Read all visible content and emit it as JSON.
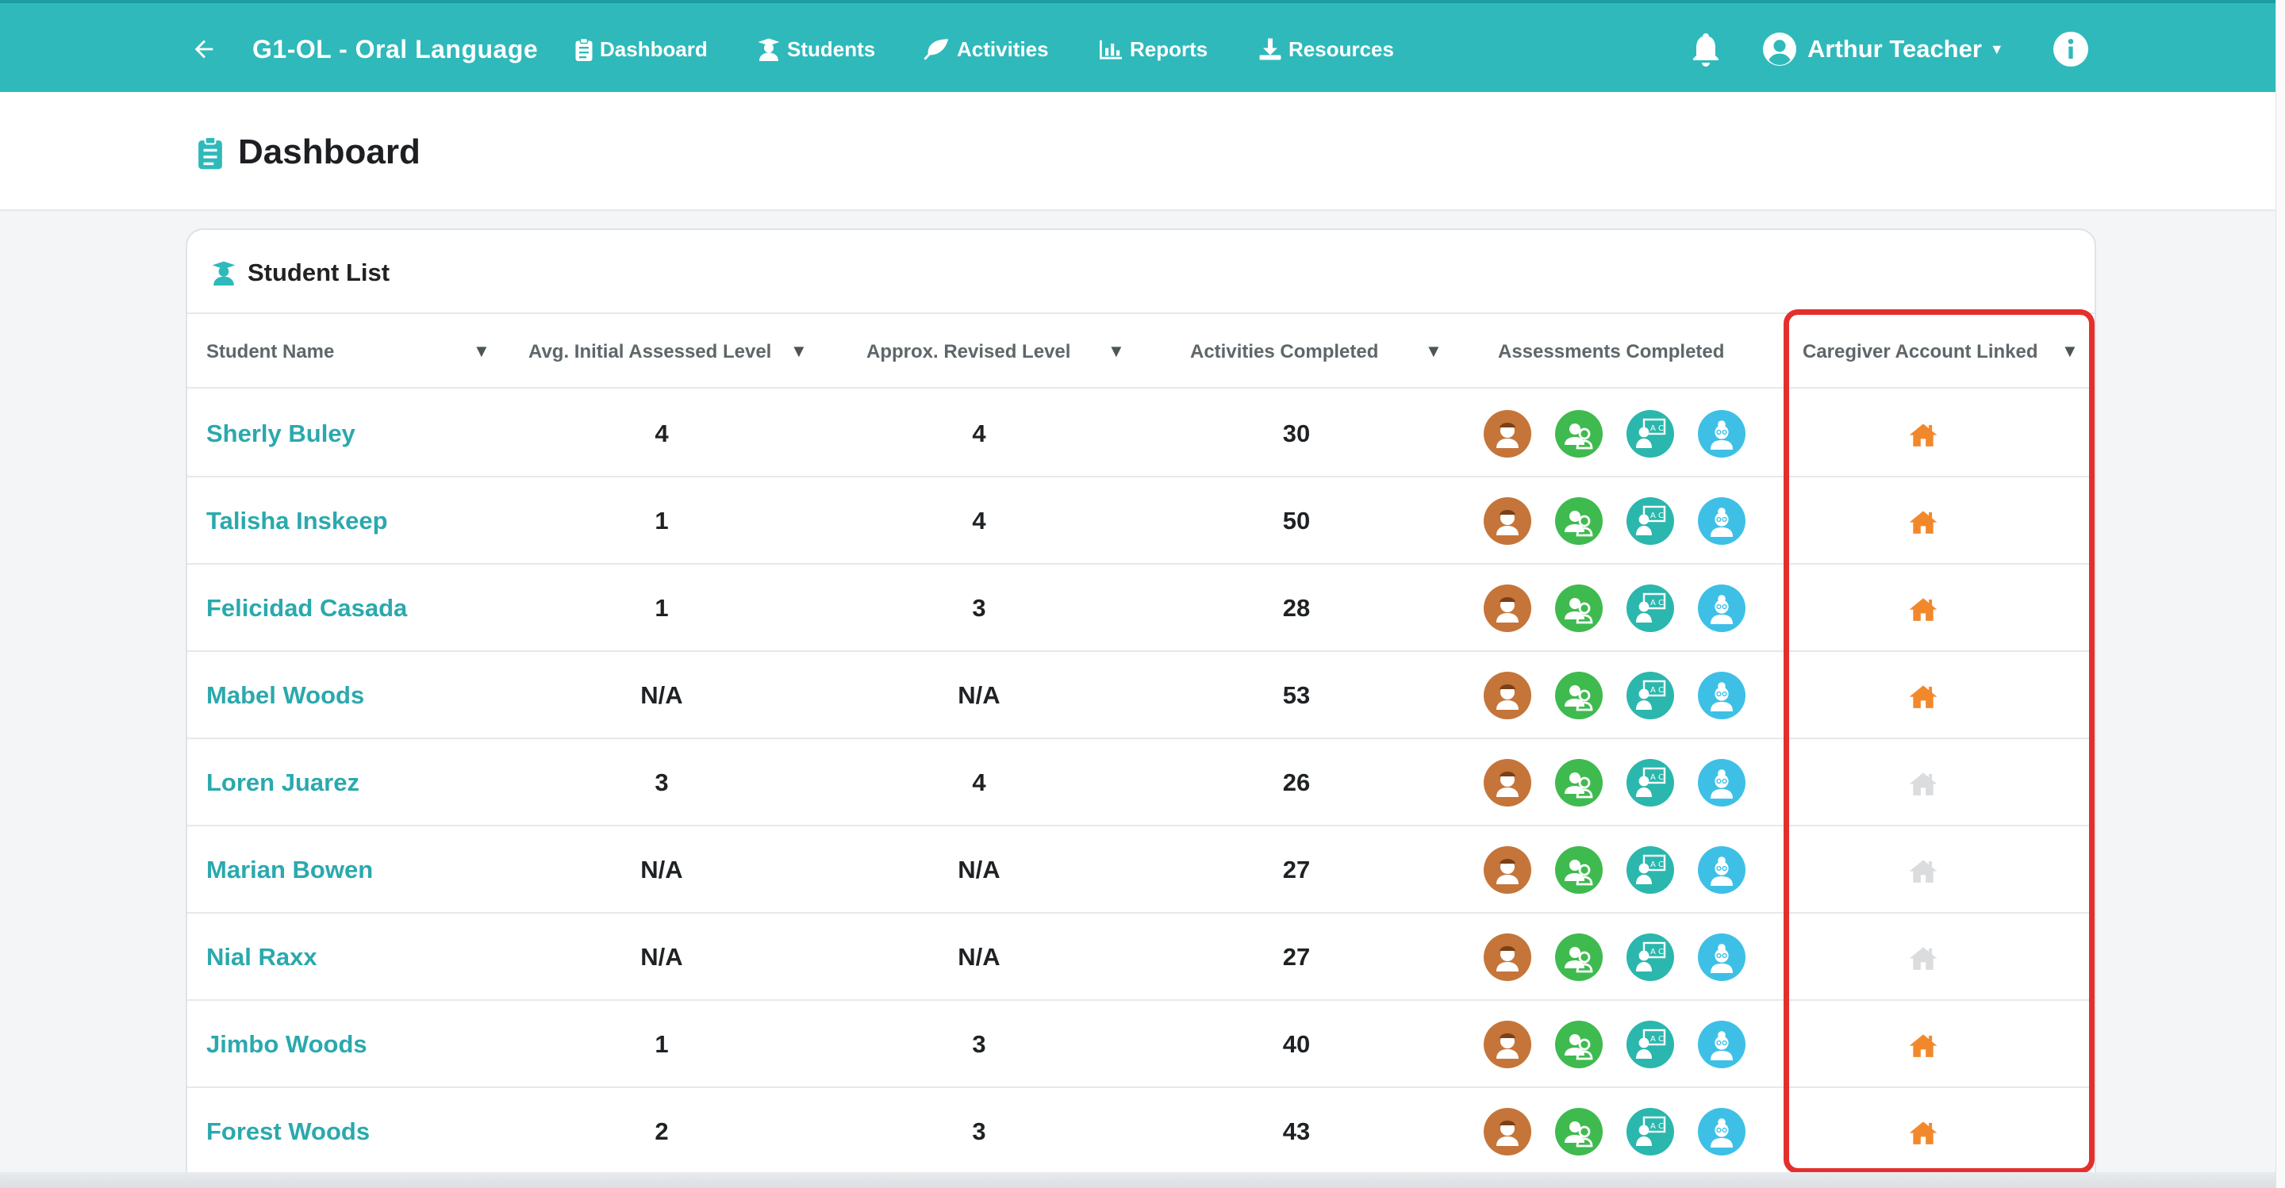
{
  "nav": {
    "back_icon": "arrow-left-icon",
    "course_title": "G1-OL - Oral Language",
    "links": [
      {
        "label": "Dashboard",
        "icon": "clipboard-icon"
      },
      {
        "label": "Students",
        "icon": "student-icon"
      },
      {
        "label": "Activities",
        "icon": "leaf-icon"
      },
      {
        "label": "Reports",
        "icon": "bar-chart-icon"
      },
      {
        "label": "Resources",
        "icon": "download-icon"
      }
    ],
    "bell_icon": "bell-icon",
    "user_name": "Arthur Teacher",
    "info_icon": "info-icon"
  },
  "page": {
    "title": "Dashboard"
  },
  "student_list": {
    "title": "Student List",
    "columns": {
      "name": "Student Name",
      "initial": "Avg. Initial Assessed Level",
      "revised": "Approx. Revised Level",
      "activities": "Activities Completed",
      "assessments": "Assessments Completed",
      "caregiver": "Caregiver Account Linked"
    },
    "rows": [
      {
        "name": "Sherly Buley",
        "initial": "4",
        "revised": "4",
        "activities": "30",
        "caregiver_linked": true
      },
      {
        "name": "Talisha Inskeep",
        "initial": "1",
        "revised": "4",
        "activities": "50",
        "caregiver_linked": true
      },
      {
        "name": "Felicidad Casada",
        "initial": "1",
        "revised": "3",
        "activities": "28",
        "caregiver_linked": true
      },
      {
        "name": "Mabel Woods",
        "initial": "N/A",
        "revised": "N/A",
        "activities": "53",
        "caregiver_linked": true
      },
      {
        "name": "Loren Juarez",
        "initial": "3",
        "revised": "4",
        "activities": "26",
        "caregiver_linked": false
      },
      {
        "name": "Marian Bowen",
        "initial": "N/A",
        "revised": "N/A",
        "activities": "27",
        "caregiver_linked": false
      },
      {
        "name": "Nial Raxx",
        "initial": "N/A",
        "revised": "N/A",
        "activities": "27",
        "caregiver_linked": false
      },
      {
        "name": "Jimbo Woods",
        "initial": "1",
        "revised": "3",
        "activities": "40",
        "caregiver_linked": true
      },
      {
        "name": "Forest Woods",
        "initial": "2",
        "revised": "3",
        "activities": "43",
        "caregiver_linked": true
      }
    ]
  },
  "colors": {
    "nav_bg": "#2fb9bb",
    "link_teal": "#2aa9ad",
    "home_linked": "#f2882c",
    "home_unlinked": "#dadcde",
    "highlight": "#e3302c"
  }
}
